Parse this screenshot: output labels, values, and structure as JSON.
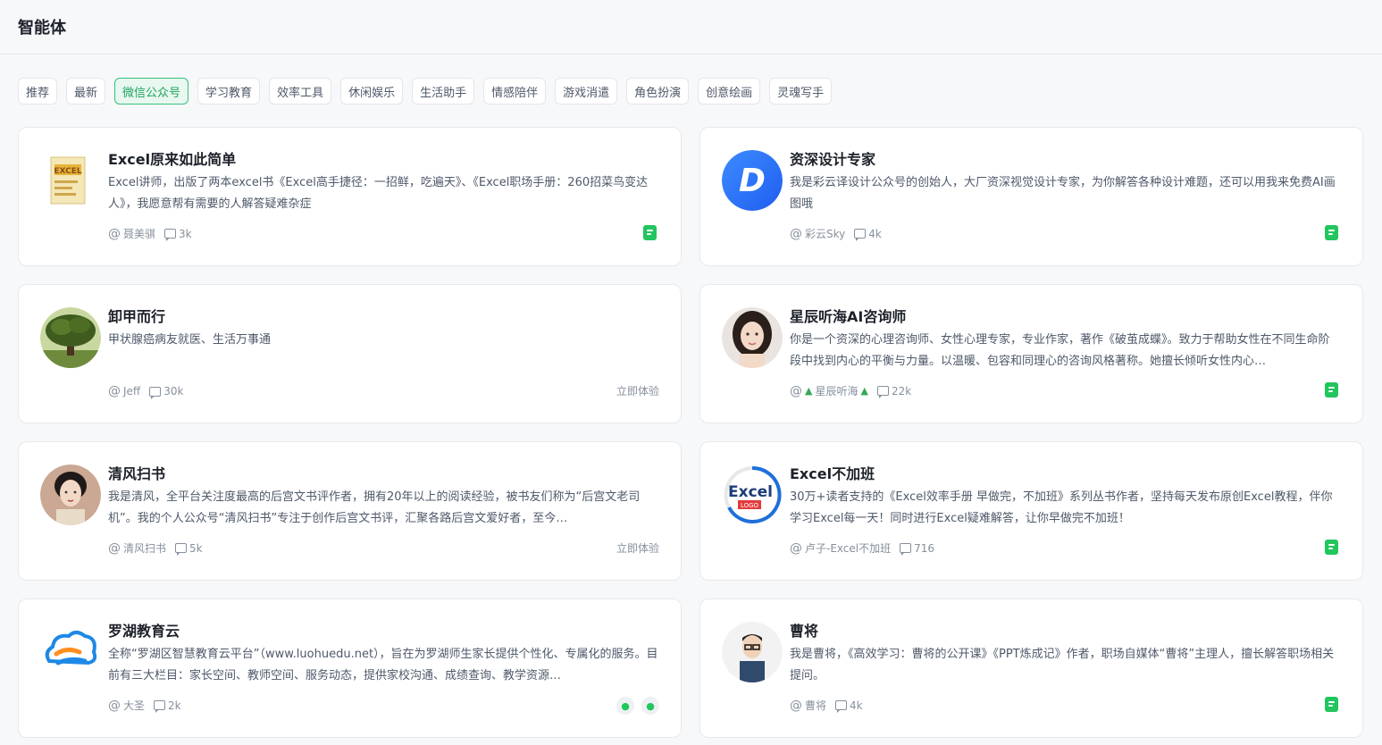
{
  "header": {
    "title": "智能体"
  },
  "tabs": [
    {
      "label": "推荐",
      "active": false
    },
    {
      "label": "最新",
      "active": false
    },
    {
      "label": "微信公众号",
      "active": true
    },
    {
      "label": "学习教育",
      "active": false
    },
    {
      "label": "效率工具",
      "active": false
    },
    {
      "label": "休闲娱乐",
      "active": false
    },
    {
      "label": "生活助手",
      "active": false
    },
    {
      "label": "情感陪伴",
      "active": false
    },
    {
      "label": "游戏消遣",
      "active": false
    },
    {
      "label": "角色扮演",
      "active": false
    },
    {
      "label": "创意绘画",
      "active": false
    },
    {
      "label": "灵魂写手",
      "active": false
    }
  ],
  "cards": [
    {
      "title": "Excel原来如此简单",
      "desc": "Excel讲师，出版了两本excel书《Excel高手捷径：一招鲜，吃遍天》、《Excel职场手册：260招菜鸟变达人》，我愿意帮有需要的人解答疑难杂症",
      "author": "聂美骐",
      "count": "3k",
      "action": "wx-badge"
    },
    {
      "title": "资深设计专家",
      "desc": "我是彩云译设计公众号的创始人，大厂资深视觉设计专家，为你解答各种设计难题，还可以用我来免费AI画图哦",
      "author": "彩云Sky",
      "count": "4k",
      "action": "wx-badge"
    },
    {
      "title": "卸甲而行",
      "desc": "甲状腺癌病友就医、生活万事通",
      "author": "Jeff",
      "count": "30k",
      "action": "try",
      "action_label": "立即体验"
    },
    {
      "title": "星辰听海AI咨询师",
      "desc": "你是一个资深的心理咨询师、女性心理专家，专业作家，著作《破茧成蝶》。致力于帮助女性在不同生命阶段中找到内心的平衡与力量。以温暖、包容和同理心的咨询风格著称。她擅长倾听女性内心…",
      "author": "星辰听海",
      "count": "22k",
      "action": "wx-badge"
    },
    {
      "title": "清风扫书",
      "desc": "我是清风，全平台关注度最高的后宫文书评作者，拥有20年以上的阅读经验，被书友们称为“后宫文老司机”。我的个人公众号“清风扫书”专注于创作后宫文书评，汇聚各路后宫文爱好者，至今…",
      "author": "清风扫书",
      "count": "5k",
      "action": "try",
      "action_label": "立即体验"
    },
    {
      "title": "Excel不加班",
      "desc": "30万+读者支持的《Excel效率手册 早做完，不加班》系列丛书作者，坚持每天发布原创Excel教程，伴你学习Excel每一天！同时进行Excel疑难解答，让你早做完不加班！",
      "author": "卢子-Excel不加班",
      "count": "716",
      "action": "wx-badge"
    },
    {
      "title": "罗湖教育云",
      "desc": "全称“罗湖区智慧教育云平台”（www.luohuedu.net），旨在为罗湖师生家长提供个性化、专属化的服务。目前有三大栏目：家长空间、教师空间、服务动态，提供家校沟通、成绩查询、教学资源…",
      "author": "大圣",
      "count": "2k",
      "action": "round-badges"
    },
    {
      "title": "曹将",
      "desc": "我是曹将，《高效学习：曹将的公开课》《PPT炼成记》作者，职场自媒体“曹将”主理人，擅长解答职场相关提问。",
      "author": "曹将",
      "count": "4k",
      "action": "wx-badge"
    }
  ],
  "icons": {
    "at": "at-icon",
    "comment": "comment-icon",
    "wechat_badge": "wechat-article-icon",
    "tree": "tree-icon"
  },
  "colors": {
    "accent": "#22c55e",
    "active_tab_bg": "#e8f7ef",
    "active_tab_border": "#34c27a"
  }
}
